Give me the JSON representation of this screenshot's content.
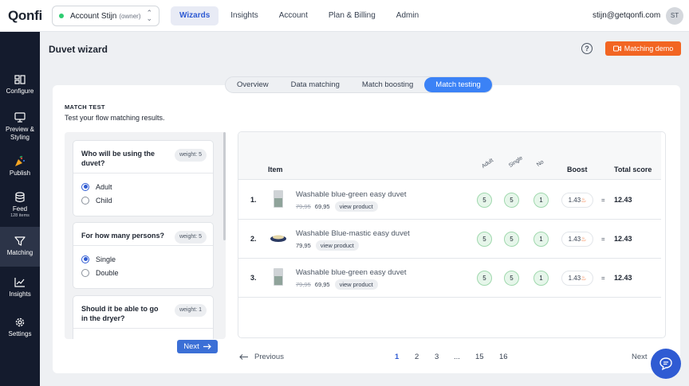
{
  "app": {
    "logo": "Qonfi"
  },
  "account": {
    "name": "Account Stijn",
    "role": "(owner)"
  },
  "topnav": [
    "Wizards",
    "Insights",
    "Account",
    "Plan & Billing",
    "Admin"
  ],
  "user": {
    "email": "stijn@getqonfi.com",
    "initials": "ST"
  },
  "sidebar": [
    {
      "label": "Configure",
      "icon": "configure-icon"
    },
    {
      "label": "Preview & Styling",
      "icon": "monitor-icon"
    },
    {
      "label": "Publish",
      "icon": "party-icon"
    },
    {
      "label": "Feed",
      "sub": "128 items",
      "icon": "database-icon"
    },
    {
      "label": "Matching",
      "icon": "filter-icon"
    },
    {
      "label": "Insights",
      "icon": "chart-icon"
    },
    {
      "label": "Settings",
      "icon": "gear-icon"
    }
  ],
  "page": {
    "title": "Duvet wizard",
    "demo_button": "Matching demo"
  },
  "tabs": [
    "Overview",
    "Data matching",
    "Match boosting",
    "Match testing"
  ],
  "match_test": {
    "title": "MATCH TEST",
    "subtitle": "Test your flow matching results."
  },
  "questions": [
    {
      "text": "Who will be using the duvet?",
      "weight": "weight: 5",
      "options": [
        {
          "label": "Adult",
          "selected": true
        },
        {
          "label": "Child",
          "selected": false
        }
      ]
    },
    {
      "text": "For how many persons?",
      "weight": "weight: 5",
      "options": [
        {
          "label": "Single",
          "selected": true
        },
        {
          "label": "Double",
          "selected": false
        }
      ]
    },
    {
      "text": "Should it be able to go in the dryer?",
      "weight": "weight: 1",
      "options": []
    }
  ],
  "next_button": "Next",
  "results": {
    "headers": {
      "item": "Item",
      "adult": "Adult",
      "single": "Single",
      "no": "No",
      "boost": "Boost",
      "total": "Total score"
    },
    "rows": [
      {
        "rank": "1.",
        "name": "Washable blue-green easy duvet",
        "old_price": "79,95",
        "price": "69,95",
        "view": "view product",
        "scores": [
          "5",
          "5",
          "1"
        ],
        "boost": "1.43",
        "total": "12.43"
      },
      {
        "rank": "2.",
        "name": "Washable Blue-mastic easy duvet",
        "old_price": "",
        "price": "79,95",
        "view": "view product",
        "scores": [
          "5",
          "5",
          "1"
        ],
        "boost": "1.43",
        "total": "12.43"
      },
      {
        "rank": "3.",
        "name": "Washable blue-green easy duvet",
        "old_price": "79,95",
        "price": "69,95",
        "view": "view product",
        "scores": [
          "5",
          "5",
          "1"
        ],
        "boost": "1.43",
        "total": "12.43"
      }
    ],
    "equals": "="
  },
  "pagination": {
    "previous": "Previous",
    "next": "Next",
    "pages": [
      "1",
      "2",
      "3",
      "...",
      "15",
      "16"
    ],
    "current": "1"
  },
  "colors": {
    "accent": "#2f5bd3",
    "orange": "#f26522",
    "sidebar": "#141b2d"
  }
}
